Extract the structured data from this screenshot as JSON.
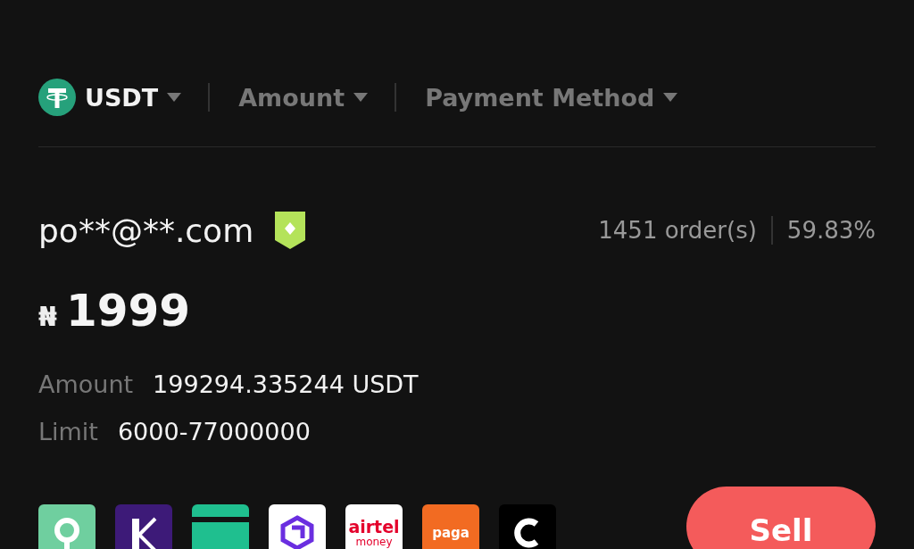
{
  "filters": [
    {
      "kind": "coin",
      "label": "USDT",
      "selected": true
    },
    {
      "kind": "plain",
      "label": "Amount",
      "selected": false
    },
    {
      "kind": "plain",
      "label": "Payment Method",
      "selected": false
    }
  ],
  "merchant": {
    "name": "po**@**.com",
    "verified": true,
    "orders": "1451 order(s)",
    "completion": "59.83%"
  },
  "price": {
    "currency": "₦",
    "value": "1999"
  },
  "details": [
    {
      "label": "Amount",
      "value": "199294.335244 USDT"
    },
    {
      "label": "Limit",
      "value": "6000-77000000"
    }
  ],
  "payment_methods": [
    {
      "kind": "ring",
      "color": "#6fcf9f"
    },
    {
      "kind": "k",
      "color": "#3d1a78"
    },
    {
      "kind": "card",
      "color": "#1fbf8f"
    },
    {
      "kind": "hex",
      "color": "#ffffff"
    },
    {
      "kind": "text",
      "color": "#ffffff",
      "label": "airtel",
      "sublabel": "money"
    },
    {
      "kind": "text",
      "color": "#f26b22",
      "label": "paga"
    },
    {
      "kind": "c",
      "color": "#000000"
    }
  ],
  "action": {
    "label": "Sell"
  }
}
